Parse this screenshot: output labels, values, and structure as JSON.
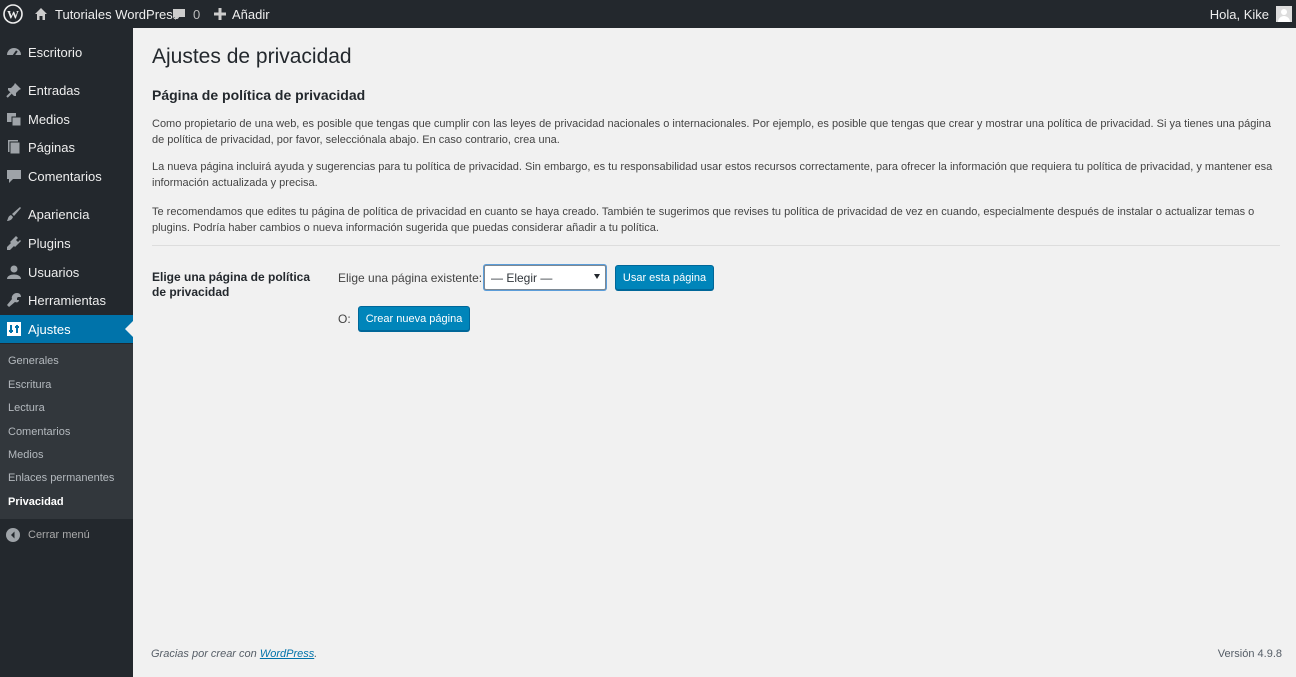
{
  "adminbar": {
    "logo_icon": "wordpress-logo-icon",
    "site_name": "Tutoriales WordPress",
    "comments_count": "0",
    "new_label": "Añadir",
    "greeting": "Hola, Kike"
  },
  "sidebar": {
    "items": [
      {
        "label": "Escritorio",
        "icon": "dashboard-icon"
      },
      {
        "label": "Entradas",
        "icon": "pushpin-icon"
      },
      {
        "label": "Medios",
        "icon": "media-icon"
      },
      {
        "label": "Páginas",
        "icon": "pages-icon"
      },
      {
        "label": "Comentarios",
        "icon": "comments-icon"
      },
      {
        "label": "Apariencia",
        "icon": "paintbrush-icon"
      },
      {
        "label": "Plugins",
        "icon": "plugin-icon"
      },
      {
        "label": "Usuarios",
        "icon": "users-icon"
      },
      {
        "label": "Herramientas",
        "icon": "wrench-icon"
      },
      {
        "label": "Ajustes",
        "icon": "settings-icon"
      }
    ],
    "submenu": [
      "Generales",
      "Escritura",
      "Lectura",
      "Comentarios",
      "Medios",
      "Enlaces permanentes",
      "Privacidad"
    ],
    "collapse_label": "Cerrar menú"
  },
  "main": {
    "page_title": "Ajustes de privacidad",
    "section_title": "Página de política de privacidad",
    "paragraphs": [
      "Como propietario de una web, es posible que tengas que cumplir con las leyes de privacidad nacionales o internacionales. Por ejemplo, es posible que tengas que crear y mostrar una política de privacidad. Si ya tienes una página de política de privacidad, por favor, selecciónala abajo. En caso contrario, crea una.",
      "La nueva página incluirá ayuda y sugerencias para tu política de privacidad. Sin embargo, es tu responsabilidad usar estos recursos correctamente, para ofrecer la información que requiera tu política de privacidad, y mantener esa información actualizada y precisa.",
      "Te recomendamos que edites tu página de política de privacidad en cuanto se haya creado. También te sugerimos que revises tu política de privacidad de vez en cuando, especialmente después de instalar o actualizar temas o plugins. Podría haber cambios o nueva información sugerida que puedas considerar añadir a tu política."
    ],
    "field_label": "Elige una página de política de privacidad",
    "existing_label": "Elige una página existente:",
    "select_value": "— Elegir —",
    "use_button": "Usar esta página",
    "or_label": "O:",
    "create_button": "Crear nueva página"
  },
  "footer": {
    "thanks_prefix": "Gracias por crear con ",
    "thanks_link": "WordPress",
    "thanks_suffix": ".",
    "version": "Versión 4.9.8"
  },
  "colors": {
    "adminbar_bg": "#23282d",
    "accent": "#0073aa",
    "button": "#0085ba",
    "background": "#f1f1f1"
  }
}
